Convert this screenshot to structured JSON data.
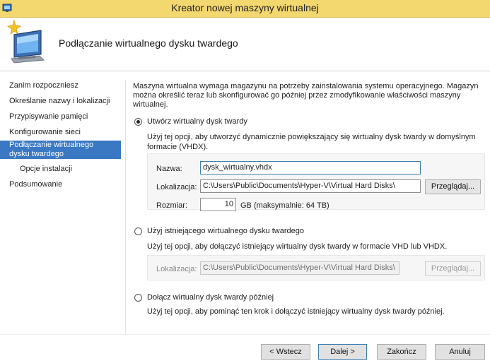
{
  "window": {
    "title": "Kreator nowej maszyny wirtualnej"
  },
  "header": {
    "title": "Podłączanie wirtualnego dysku twardego"
  },
  "sidebar": {
    "items": [
      {
        "label": "Zanim rozpoczniesz"
      },
      {
        "label": "Określanie nazwy i lokalizacji"
      },
      {
        "label": "Przypisywanie pamięci"
      },
      {
        "label": "Konfigurowanie sieci"
      },
      {
        "label": "Podłączanie wirtualnego dysku twardego"
      },
      {
        "label": "Opcje instalacji"
      },
      {
        "label": "Podsumowanie"
      }
    ]
  },
  "main": {
    "intro": "Maszyna wirtualna wymaga magazynu na potrzeby zainstalowania systemu operacyjnego. Magazyn można określić teraz lub skonfigurować go później przez zmodyfikowanie właściwości maszyny wirtualnej.",
    "option_create": {
      "label": "Utwórz wirtualny dysk twardy",
      "desc": "Użyj tej opcji, aby utworzyć dynamicznie powiększający się wirtualny dysk twardy w domyślnym formacie (VHDX).",
      "name_label": "Nazwa:",
      "name_value": "dysk_wirtualny.vhdx",
      "location_label": "Lokalizacja:",
      "location_value": "C:\\Users\\Public\\Documents\\Hyper-V\\Virtual Hard Disks\\",
      "browse_label": "Przeglądaj...",
      "size_label": "Rozmiar:",
      "size_value": "10",
      "size_unit": "GB (maksymalnie: 64 TB)"
    },
    "option_existing": {
      "label": "Użyj istniejącego wirtualnego dysku twardego",
      "desc": "Użyj tej opcji, aby dołączyć istniejący wirtualny dysk twardy w formacie VHD lub VHDX.",
      "location_label": "Lokalizacja:",
      "location_value": "C:\\Users\\Public\\Documents\\Hyper-V\\Virtual Hard Disks\\",
      "browse_label": "Przeglądaj..."
    },
    "option_later": {
      "label": "Dołącz wirtualny dysk twardy później",
      "desc": "Użyj tej opcji, aby pominąć ten krok i dołączyć istniejący wirtualny dysk twardy później."
    }
  },
  "footer": {
    "back_label": "< Wstecz",
    "next_label": "Dalej >",
    "finish_label": "Zakończ",
    "cancel_label": "Anuluj"
  },
  "colors": {
    "titlebar": "#f3d76f",
    "selection": "#3a78c3",
    "focus_border": "#3c7fb1"
  },
  "icons": {
    "app": "hyper-v-icon",
    "wizard": "computer-sparkle-icon"
  }
}
